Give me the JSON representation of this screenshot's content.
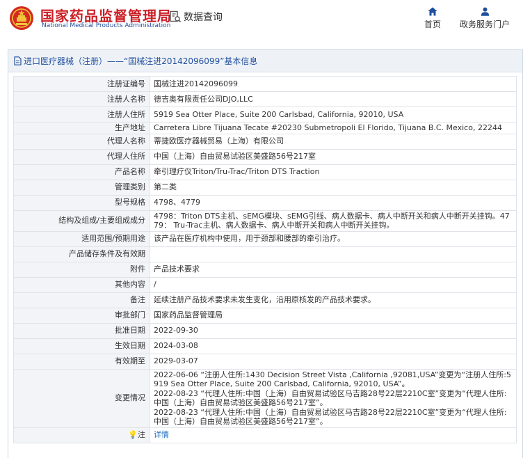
{
  "header": {
    "brand_cn": "国家药品监督管理局",
    "brand_en": "National Medical Products Administration",
    "search_label": "数据查询",
    "nav": [
      {
        "label": "首页",
        "icon": "home-icon"
      },
      {
        "label": "政务服务门户",
        "icon": "user-icon"
      }
    ],
    "brand_color": "#cc1f26",
    "accent_color": "#1f4e9c"
  },
  "panel": {
    "title": "进口医疗器械（注册）——“国械注进20142096099”基本信息",
    "title_icon": "document-icon"
  },
  "rows": [
    {
      "key": "注册证编号",
      "value": "国械注进20142096099"
    },
    {
      "key": "注册人名称",
      "value": "德吉奥有限责任公司DJO,LLC"
    },
    {
      "key": "注册人住所",
      "value": "5919 Sea Otter Place, Suite 200 Carlsbad, California, 92010, USA"
    },
    {
      "key": "生产地址",
      "value": "Carretera Libre Tijuana Tecate #20230 Submetropoli El Florido, Tijuana B.C. Mexico, 22244"
    },
    {
      "key": "代理人名称",
      "value": "蒂捷欧医疗器械贸易（上海）有限公司"
    },
    {
      "key": "代理人住所",
      "value": "中国（上海）自由贸易试验区美盛路56号217室"
    },
    {
      "key": "产品名称",
      "value": "牵引理疗仪Triton/Tru-Trac/Triton DTS Traction"
    },
    {
      "key": "管理类别",
      "value": "第二类"
    },
    {
      "key": "型号规格",
      "value": "4798、4779"
    },
    {
      "key": "结构及组成/主要组成成分",
      "value": "4798：Triton DTS主机、sEMG模块、sEMG引线、病人数据卡、病人中断开关和病人中断开关挂钩。4779： Tru-Trac主机、病人数据卡、病人中断开关和病人中断开关挂钩。"
    },
    {
      "key": "适用范围/预期用途",
      "value": "该产品在医疗机构中使用，用于颈部和腰部的牵引治疗。"
    },
    {
      "key": "产品储存条件及有效期",
      "value": ""
    },
    {
      "key": "附件",
      "value": "产品技术要求"
    },
    {
      "key": "其他内容",
      "value": "/"
    },
    {
      "key": "备注",
      "value": "延续注册产品技术要求未发生变化，沿用原核发的产品技术要求。"
    },
    {
      "key": "审批部门",
      "value": "国家药品监督管理局"
    },
    {
      "key": "批准日期",
      "value": "2022-09-30"
    },
    {
      "key": "生效日期",
      "value": "2024-03-08"
    },
    {
      "key": "有效期至",
      "value": "2029-03-07"
    }
  ],
  "changes": {
    "key": "变更情况",
    "lines": [
      "2022-06-06 “注册人住所:1430 Decision Street Vista ,California ,92081,USA”变更为“注册人住所:5919 Sea Otter Place, Suite 200 Carlsbad, California, 92010, USA”。",
      "2022-08-23 “代理人住所:中国（上海）自由贸易试验区马吉路28号22层2210C室”变更为“代理人住所:中国（上海）自由贸易试验区美盛路56号217室”。",
      "2022-08-23 “代理人住所:中国（上海）自由贸易试验区马吉路28号22层2210C室”变更为“代理人住所:中国（上海）自由贸易试验区美盛路56号217室”。"
    ]
  },
  "note": {
    "key": "注",
    "icon": "lightbulb-icon",
    "link": "详情"
  }
}
